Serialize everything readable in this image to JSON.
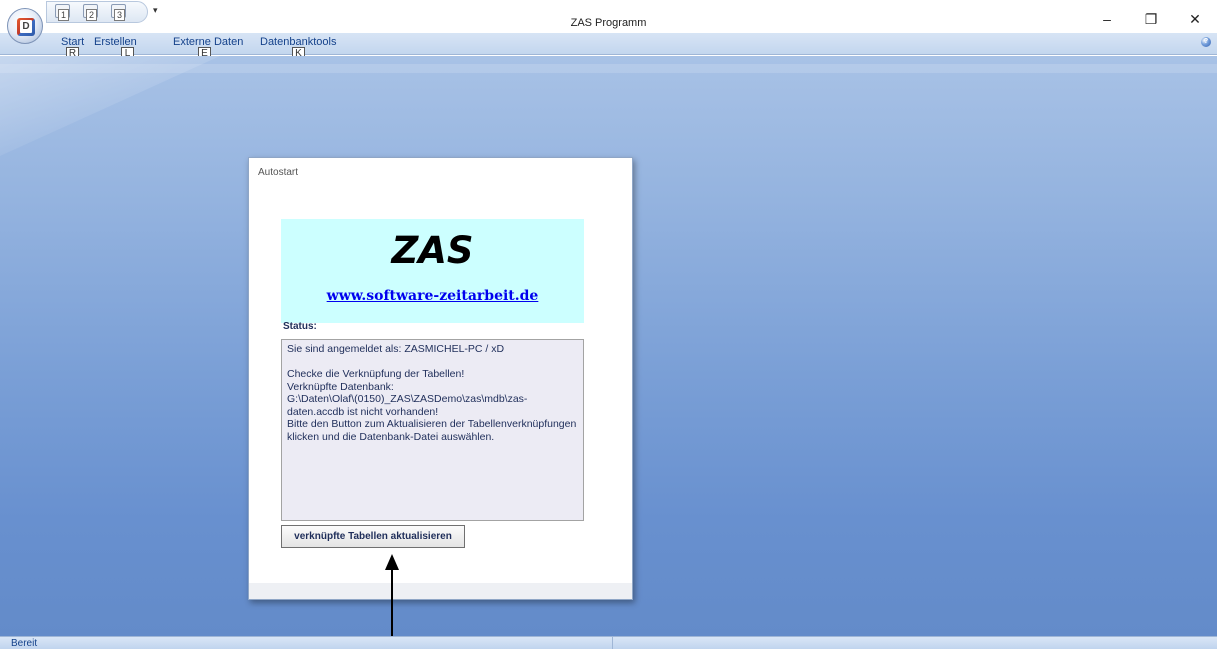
{
  "window": {
    "title": "ZAS Programm",
    "controls": {
      "minimize": "–",
      "restore": "❐",
      "close": "✕"
    }
  },
  "office_button": {
    "icon": "office-logo",
    "letter": "D",
    "keytip": "D"
  },
  "quick_access": {
    "buttons": [
      {
        "icon": "save-icon",
        "keytip": "1"
      },
      {
        "icon": "undo-icon",
        "keytip": "2"
      },
      {
        "icon": "redo-icon",
        "keytip": "3"
      }
    ],
    "more": "▾"
  },
  "ribbon": {
    "tabs": [
      {
        "label": "Start",
        "keytip": "R"
      },
      {
        "label": "Erstellen",
        "keytip": "L"
      },
      {
        "label": "Externe Daten",
        "keytip": "E"
      },
      {
        "label": "Datenbanktools",
        "keytip": "K"
      }
    ],
    "help": "?"
  },
  "form": {
    "caption": "Autostart",
    "banner_title": "ZAS",
    "banner_link": "www.software-zeitarbeit.de",
    "status_label": "Status:",
    "status_text": "Sie sind angemeldet als: ZASMICHEL-PC / xD\n\nChecke die Verknüpfung der Tabellen!\nVerknüpfte Datenbank:\nG:\\Daten\\Olaf\\(0150)_ZAS\\ZASDemo\\zas\\mdb\\zas-daten.accdb ist nicht vorhanden!\nBitte den Button zum Aktualisieren der Tabellenverknüpfungen klicken und die Datenbank-Datei auswählen.",
    "update_button": "verknüpfte Tabellen aktualisieren"
  },
  "statusbar": {
    "text": "Bereit"
  },
  "colors": {
    "banner_bg": "#ccffff",
    "link": "#0000ee",
    "status_text": "#1f2e5a",
    "workspace": "#7a9fd6"
  }
}
